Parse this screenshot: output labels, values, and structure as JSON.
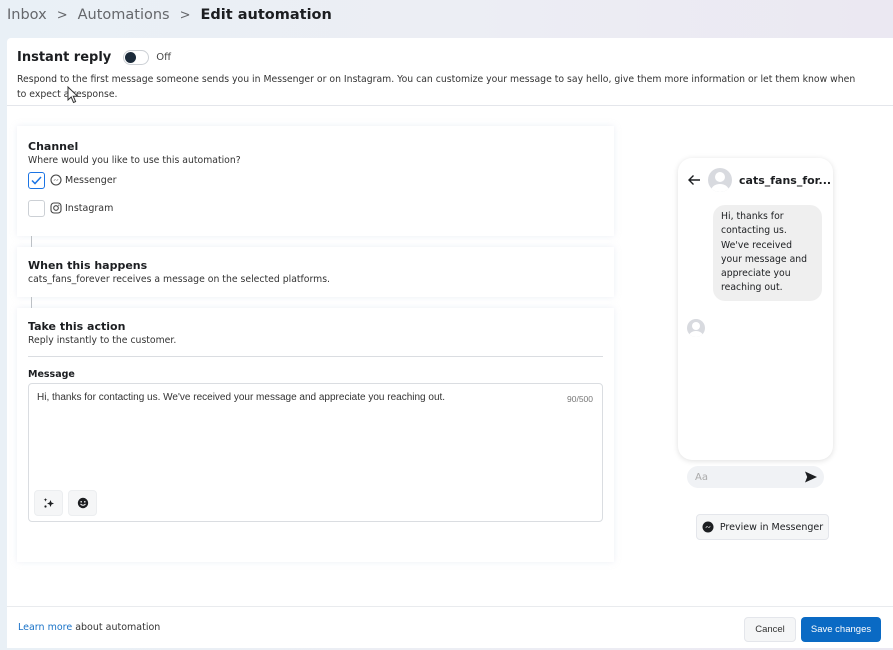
{
  "breadcrumb": {
    "items": [
      "Inbox",
      "Automations"
    ],
    "current": "Edit automation",
    "separator": ">"
  },
  "header": {
    "title": "Instant reply",
    "toggle": {
      "state": "off",
      "label": "Off"
    },
    "description": "Respond to the first message someone sends you in Messenger or on Instagram. You can customize your message to say hello, give them more information or let them know when to expect a response."
  },
  "channel": {
    "title": "Channel",
    "subtitle": "Where would you like to use this automation?",
    "options": [
      {
        "label": "Messenger",
        "icon": "messenger-icon",
        "checked": true
      },
      {
        "label": "Instagram",
        "icon": "instagram-icon",
        "checked": false
      }
    ]
  },
  "trigger": {
    "title": "When this happens",
    "subtitle": "cats_fans_forever receives a message on the selected platforms."
  },
  "action": {
    "title": "Take this action",
    "subtitle": "Reply instantly to the customer.",
    "message_label": "Message",
    "message_value": "Hi, thanks for contacting us. We've received your message and appreciate you reaching out.",
    "char_count": "90/500",
    "tools": [
      "sparkles-icon",
      "emoji-icon"
    ]
  },
  "preview": {
    "account_name": "cats_fans_for...",
    "bubble_text": "Hi, thanks for contacting us. We've received your message and appreciate you reaching out.",
    "composer_placeholder": "Aa",
    "preview_button": "Preview in Messenger"
  },
  "footer": {
    "learn_link": "Learn more",
    "learn_suffix": " about automation",
    "cancel": "Cancel",
    "save": "Save changes"
  },
  "colors": {
    "primary": "#0a6ac4",
    "link": "#1a73c8",
    "checkbox_accent": "#1b74e4"
  }
}
